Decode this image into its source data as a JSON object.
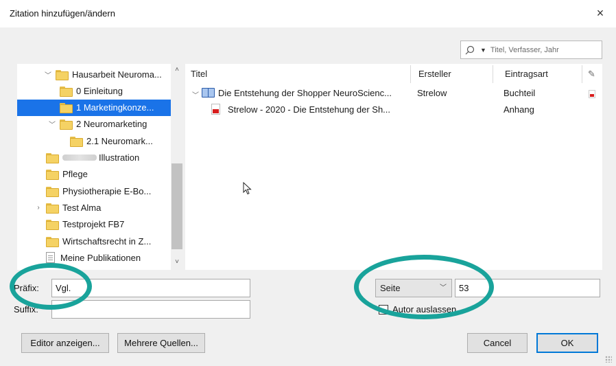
{
  "dialog": {
    "title": "Zitation hinzufügen/ändern",
    "close_glyph": "×"
  },
  "search": {
    "placeholder": "Titel, Verfasser, Jahr"
  },
  "tree": {
    "items": [
      {
        "label": "Hausarbeit Neuroma...",
        "indent": 1,
        "toggle": "﹀",
        "kind": "folder"
      },
      {
        "label": "0 Einleitung",
        "indent": 2,
        "toggle": "",
        "kind": "folder"
      },
      {
        "label": "1 Marketingkonze...",
        "indent": 2,
        "toggle": "",
        "kind": "folder",
        "selected": true
      },
      {
        "label": "2 Neuromarketing",
        "indent": 2,
        "toggle": "﹀",
        "kind": "folder"
      },
      {
        "label": "2.1 Neuromark...",
        "indent": 3,
        "toggle": "",
        "kind": "folder"
      },
      {
        "label": "Illustration",
        "indent": 0,
        "toggle": "",
        "kind": "folder",
        "redacted": true
      },
      {
        "label": "Pflege",
        "indent": 0,
        "toggle": "",
        "kind": "folder"
      },
      {
        "label": "Physiotherapie E-Bo...",
        "indent": 0,
        "toggle": "",
        "kind": "folder"
      },
      {
        "label": "Test Alma",
        "indent": 0,
        "toggle": "›",
        "kind": "folder"
      },
      {
        "label": "Testprojekt FB7",
        "indent": 0,
        "toggle": "",
        "kind": "folder"
      },
      {
        "label": "Wirtschaftsrecht in Z...",
        "indent": 0,
        "toggle": "",
        "kind": "folder"
      },
      {
        "label": "Meine Publikationen",
        "indent": 0,
        "toggle": "",
        "kind": "doc"
      }
    ]
  },
  "list": {
    "columns": {
      "title": "Titel",
      "creator": "Ersteller",
      "type": "Eintragsart"
    },
    "rows": [
      {
        "title": "Die Entstehung der Shopper NeuroScienc...",
        "creator": "Strelow",
        "type": "Buchteil"
      },
      {
        "title": "Strelow - 2020 - Die Entstehung der Sh...",
        "creator": "",
        "type": "Anhang"
      }
    ]
  },
  "form": {
    "prefix_label": "Präfix:",
    "prefix_value": "Vgl.",
    "suffix_label": "Suffix:",
    "suffix_value": "",
    "locator_select": "Seite",
    "locator_value": "53",
    "omit_author_label": "Autor auslassen",
    "omit_author_checked": false
  },
  "buttons": {
    "editor": "Editor anzeigen...",
    "multiple": "Mehrere Quellen...",
    "cancel": "Cancel",
    "ok": "OK"
  },
  "colors": {
    "selection": "#1a73e8",
    "highlight_ring": "#19a39b",
    "ok_border": "#0078d7"
  }
}
